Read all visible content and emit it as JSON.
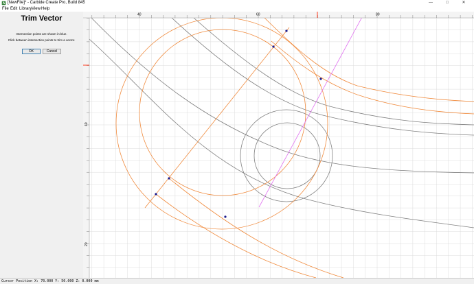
{
  "window": {
    "title": "[NewFile]* - Carbide Create Pro, Build 845",
    "minimize_glyph": "—",
    "maximize_glyph": "□",
    "close_glyph": "✕"
  },
  "menu": {
    "items": [
      {
        "label": "File"
      },
      {
        "label": "Edit"
      },
      {
        "label": "Library"
      },
      {
        "label": "View"
      },
      {
        "label": "Help"
      }
    ]
  },
  "panel": {
    "title": "Trim Vector",
    "instruction_1": "Intersection points are shown in blue.",
    "instruction_2": "Click between intersection points to trim a vector.",
    "ok_label": "OK",
    "cancel_label": "Cancel"
  },
  "ruler": {
    "top_labels": [
      "40",
      "60",
      "80"
    ],
    "left_labels": [
      "40",
      "20"
    ]
  },
  "status": {
    "cursor_position": "Cursor Position X: 70.000 Y: 50.000 Z: 0.000 mm"
  },
  "colors": {
    "vector_orange": "#f08a3c",
    "vector_gray": "#7f7f7f",
    "selected_line": "#e070f0",
    "intersection_point": "#1a1a8c",
    "grid": "#dcdcdc",
    "ruler_bg": "#f4f4f4",
    "panel_bg": "#f0f0f0",
    "ruler_marker": "#ff3b1f"
  },
  "icons": {
    "app": "carbide-create-icon"
  }
}
